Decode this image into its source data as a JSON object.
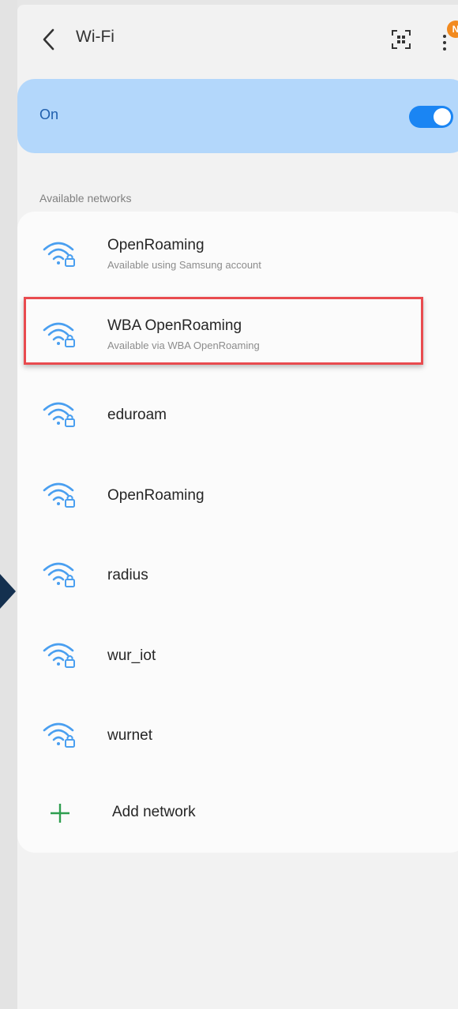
{
  "header": {
    "title": "Wi-Fi",
    "badge": "N"
  },
  "toggle": {
    "label": "On",
    "state": "on"
  },
  "section_label": "Available networks",
  "networks": [
    {
      "name": "OpenRoaming",
      "subtitle": "Available using Samsung account",
      "secured": true
    },
    {
      "name": "WBA OpenRoaming",
      "subtitle": "Available via WBA OpenRoaming",
      "secured": true,
      "highlighted": true
    },
    {
      "name": "eduroam",
      "subtitle": "",
      "secured": true
    },
    {
      "name": "OpenRoaming",
      "subtitle": "",
      "secured": true
    },
    {
      "name": "radius",
      "subtitle": "",
      "secured": true
    },
    {
      "name": "wur_iot",
      "subtitle": "",
      "secured": true
    },
    {
      "name": "wurnet",
      "subtitle": "",
      "secured": true
    }
  ],
  "add_network": {
    "label": "Add network"
  },
  "colors": {
    "accent": "#1a85f3",
    "toggle_card": "#b3d7fb",
    "wifi_icon": "#4a9ff0",
    "highlight_border": "#e94b4f",
    "add_icon": "#2e9e4f",
    "badge": "#f28a1f"
  },
  "icons": [
    "back-arrow-icon",
    "qr-scan-icon",
    "more-options-icon",
    "wifi-lock-icon",
    "plus-icon"
  ]
}
